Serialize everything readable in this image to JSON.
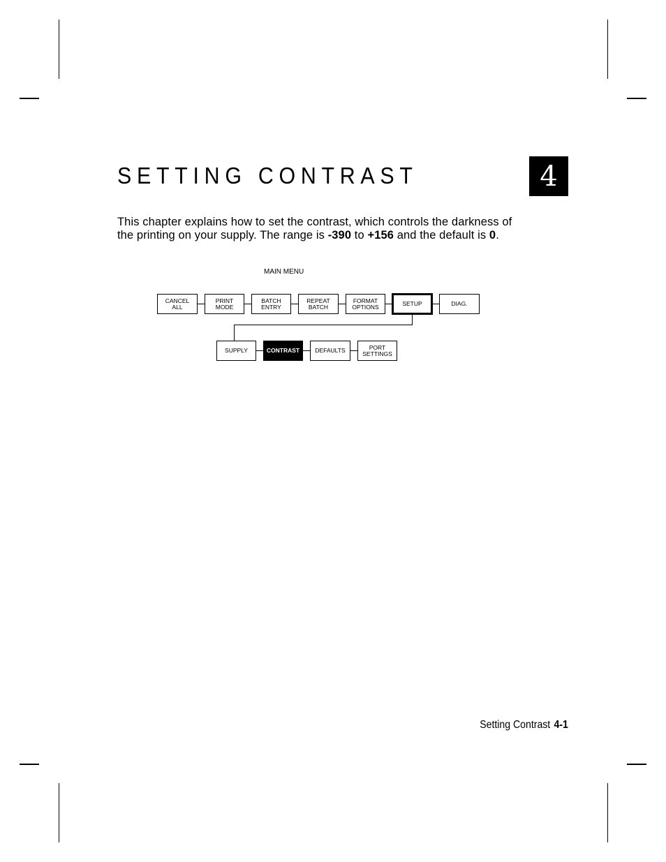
{
  "page": {
    "title": "SETTING CONTRAST",
    "chapter_number": "4",
    "intro": {
      "text_1": "This chapter explains how to set the contrast, which controls the darkness of the printing on your supply.  The range is ",
      "range_min": "-390",
      "text_2": " to ",
      "range_max": "+156",
      "text_3": " and the default is ",
      "default_value": "0",
      "text_4": "."
    }
  },
  "diagram": {
    "main_menu_label": "MAIN MENU",
    "main_menu": [
      {
        "line1": "CANCEL",
        "line2": "ALL"
      },
      {
        "line1": "PRINT",
        "line2": "MODE"
      },
      {
        "line1": "BATCH",
        "line2": "ENTRY"
      },
      {
        "line1": "REPEAT",
        "line2": "BATCH"
      },
      {
        "line1": "FORMAT",
        "line2": "OPTIONS"
      },
      {
        "line1": "SETUP",
        "line2": ""
      },
      {
        "line1": "DIAG.",
        "line2": ""
      }
    ],
    "setup_submenu": [
      {
        "line1": "SUPPLY",
        "line2": ""
      },
      {
        "line1": "CONTRAST",
        "line2": ""
      },
      {
        "line1": "DEFAULTS",
        "line2": ""
      },
      {
        "line1": "PORT",
        "line2": "SETTINGS"
      }
    ],
    "selected_main": "SETUP",
    "selected_sub": "CONTRAST"
  },
  "footer": {
    "section_title": "Setting Contrast",
    "page_number": "4-1"
  }
}
